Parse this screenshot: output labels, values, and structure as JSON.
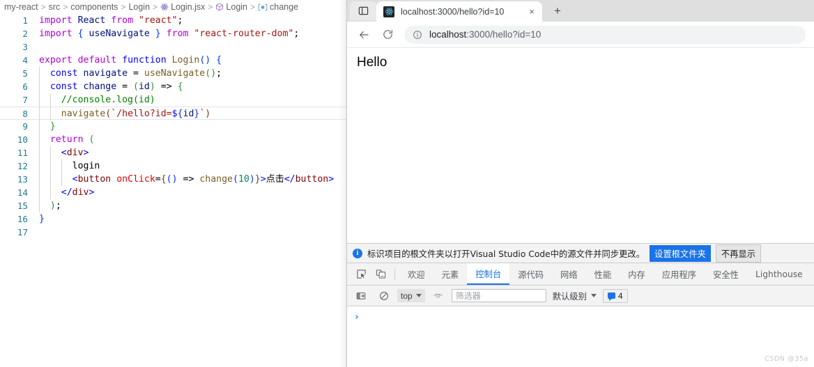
{
  "editor": {
    "breadcrumb": [
      {
        "label": "my-react",
        "icon": null
      },
      {
        "label": "src",
        "icon": null
      },
      {
        "label": "components",
        "icon": null
      },
      {
        "label": "Login",
        "icon": null
      },
      {
        "label": "Login.jsx",
        "icon": "react-file-icon"
      },
      {
        "label": "Login",
        "icon": "cube-symbol-icon"
      },
      {
        "label": "change",
        "icon": "method-symbol-icon"
      }
    ],
    "separator": ">",
    "current_line": 8,
    "lines": [
      {
        "n": "1",
        "tokens": [
          {
            "t": "import",
            "c": "t-kw"
          },
          {
            "t": " ",
            "c": "t-plain"
          },
          {
            "t": "React",
            "c": "t-var"
          },
          {
            "t": " ",
            "c": "t-plain"
          },
          {
            "t": "from",
            "c": "t-kw"
          },
          {
            "t": " ",
            "c": "t-plain"
          },
          {
            "t": "\"react\"",
            "c": "t-str"
          },
          {
            "t": ";",
            "c": "t-plain"
          }
        ]
      },
      {
        "n": "2",
        "tokens": [
          {
            "t": "import",
            "c": "t-kw"
          },
          {
            "t": " ",
            "c": "t-plain"
          },
          {
            "t": "{",
            "c": "t-brk1"
          },
          {
            "t": " ",
            "c": "t-plain"
          },
          {
            "t": "useNavigate",
            "c": "t-var"
          },
          {
            "t": " ",
            "c": "t-plain"
          },
          {
            "t": "}",
            "c": "t-brk1"
          },
          {
            "t": " ",
            "c": "t-plain"
          },
          {
            "t": "from",
            "c": "t-kw"
          },
          {
            "t": " ",
            "c": "t-plain"
          },
          {
            "t": "\"react-router-dom\"",
            "c": "t-str"
          },
          {
            "t": ";",
            "c": "t-plain"
          }
        ]
      },
      {
        "n": "3",
        "tokens": []
      },
      {
        "n": "4",
        "tokens": [
          {
            "t": "export",
            "c": "t-kw"
          },
          {
            "t": " ",
            "c": "t-plain"
          },
          {
            "t": "default",
            "c": "t-kw"
          },
          {
            "t": " ",
            "c": "t-plain"
          },
          {
            "t": "function",
            "c": "t-kw2"
          },
          {
            "t": " ",
            "c": "t-plain"
          },
          {
            "t": "Login",
            "c": "t-fn"
          },
          {
            "t": "(",
            "c": "t-brk1"
          },
          {
            "t": ")",
            "c": "t-brk1"
          },
          {
            "t": " ",
            "c": "t-plain"
          },
          {
            "t": "{",
            "c": "t-brk1"
          }
        ]
      },
      {
        "n": "5",
        "tokens": [
          {
            "t": "  ",
            "c": "t-plain"
          },
          {
            "t": "const",
            "c": "t-kw2"
          },
          {
            "t": " ",
            "c": "t-plain"
          },
          {
            "t": "navigate",
            "c": "t-var"
          },
          {
            "t": " = ",
            "c": "t-plain"
          },
          {
            "t": "useNavigate",
            "c": "t-fn"
          },
          {
            "t": "(",
            "c": "t-brk2"
          },
          {
            "t": ")",
            "c": "t-brk2"
          },
          {
            "t": ";",
            "c": "t-plain"
          }
        ]
      },
      {
        "n": "6",
        "tokens": [
          {
            "t": "  ",
            "c": "t-plain"
          },
          {
            "t": "const",
            "c": "t-kw2"
          },
          {
            "t": " ",
            "c": "t-plain"
          },
          {
            "t": "change",
            "c": "t-var"
          },
          {
            "t": " = ",
            "c": "t-plain"
          },
          {
            "t": "(",
            "c": "t-brk2"
          },
          {
            "t": "id",
            "c": "t-var"
          },
          {
            "t": ")",
            "c": "t-brk2"
          },
          {
            "t": " => ",
            "c": "t-plain"
          },
          {
            "t": "{",
            "c": "t-brk2"
          }
        ]
      },
      {
        "n": "7",
        "tokens": [
          {
            "t": "    ",
            "c": "t-plain"
          },
          {
            "t": "//console.log(id)",
            "c": "t-cmt"
          }
        ]
      },
      {
        "n": "8",
        "tokens": [
          {
            "t": "    ",
            "c": "t-plain"
          },
          {
            "t": "navigate",
            "c": "t-fn"
          },
          {
            "t": "(",
            "c": "t-brk3"
          },
          {
            "t": "`/hello?id=",
            "c": "t-str"
          },
          {
            "t": "$",
            "c": "t-sub"
          },
          {
            "t": "{",
            "c": "t-brk1"
          },
          {
            "t": "id",
            "c": "t-var"
          },
          {
            "t": "}",
            "c": "t-brk1"
          },
          {
            "t": "`",
            "c": "t-str"
          },
          {
            "t": ")",
            "c": "t-brk3"
          }
        ]
      },
      {
        "n": "9",
        "tokens": [
          {
            "t": "  ",
            "c": "t-plain"
          },
          {
            "t": "}",
            "c": "t-brk2"
          }
        ]
      },
      {
        "n": "10",
        "tokens": [
          {
            "t": "  ",
            "c": "t-plain"
          },
          {
            "t": "return",
            "c": "t-kw"
          },
          {
            "t": " ",
            "c": "t-plain"
          },
          {
            "t": "(",
            "c": "t-brk2"
          }
        ]
      },
      {
        "n": "11",
        "tokens": [
          {
            "t": "    ",
            "c": "t-plain"
          },
          {
            "t": "<",
            "c": "t-tagb"
          },
          {
            "t": "div",
            "c": "t-tag"
          },
          {
            "t": ">",
            "c": "t-tagb"
          }
        ]
      },
      {
        "n": "12",
        "tokens": [
          {
            "t": "      ",
            "c": "t-plain"
          },
          {
            "t": "login",
            "c": "t-plain"
          }
        ]
      },
      {
        "n": "13",
        "tokens": [
          {
            "t": "      ",
            "c": "t-plain"
          },
          {
            "t": "<",
            "c": "t-tagb"
          },
          {
            "t": "button",
            "c": "t-tag"
          },
          {
            "t": " ",
            "c": "t-plain"
          },
          {
            "t": "onClick",
            "c": "t-attr"
          },
          {
            "t": "=",
            "c": "t-plain"
          },
          {
            "t": "{",
            "c": "t-brk3"
          },
          {
            "t": "(",
            "c": "t-brk1"
          },
          {
            "t": ")",
            "c": "t-brk1"
          },
          {
            "t": " => ",
            "c": "t-plain"
          },
          {
            "t": "change",
            "c": "t-fn"
          },
          {
            "t": "(",
            "c": "t-brk1"
          },
          {
            "t": "10",
            "c": "t-num"
          },
          {
            "t": ")",
            "c": "t-brk1"
          },
          {
            "t": "}",
            "c": "t-brk3"
          },
          {
            "t": ">",
            "c": "t-tagb"
          },
          {
            "t": "点击",
            "c": "t-cjk"
          },
          {
            "t": "</",
            "c": "t-tagb"
          },
          {
            "t": "button",
            "c": "t-tag"
          },
          {
            "t": ">",
            "c": "t-tagb"
          }
        ]
      },
      {
        "n": "14",
        "tokens": [
          {
            "t": "    ",
            "c": "t-plain"
          },
          {
            "t": "</",
            "c": "t-tagb"
          },
          {
            "t": "div",
            "c": "t-tag"
          },
          {
            "t": ">",
            "c": "t-tagb"
          }
        ]
      },
      {
        "n": "15",
        "tokens": [
          {
            "t": "  ",
            "c": "t-plain"
          },
          {
            "t": ")",
            "c": "t-brk2"
          },
          {
            "t": ";",
            "c": "t-plain"
          }
        ]
      },
      {
        "n": "16",
        "tokens": [
          {
            "t": "}",
            "c": "t-brk1"
          }
        ]
      },
      {
        "n": "17",
        "tokens": []
      }
    ]
  },
  "browser": {
    "window_controls_icon": "tab-search-panel-icon",
    "tab": {
      "favicon": "react-favicon",
      "title": "localhost:3000/hello?id=10",
      "close_label": "×"
    },
    "new_tab_label": "+",
    "nav": {
      "back_icon": "arrow-left-icon",
      "reload_icon": "reload-icon",
      "info_icon": "info-circle-icon",
      "url_host": "localhost",
      "url_path": ":3000/hello?id=10"
    },
    "page": {
      "heading": "Hello"
    }
  },
  "devtools": {
    "notice": {
      "icon": "info-icon",
      "text": "标识项目的根文件夹以打开Visual Studio Code中的源文件并同步更改。",
      "primary_button": "设置根文件夹",
      "secondary_button": "不再显示"
    },
    "tool_icons": [
      "inspect-element-icon",
      "device-toolbar-icon"
    ],
    "tabs": [
      {
        "label": "欢迎",
        "active": false
      },
      {
        "label": "元素",
        "active": false
      },
      {
        "label": "控制台",
        "active": true
      },
      {
        "label": "源代码",
        "active": false
      },
      {
        "label": "网络",
        "active": false
      },
      {
        "label": "性能",
        "active": false
      },
      {
        "label": "内存",
        "active": false
      },
      {
        "label": "应用程序",
        "active": false
      },
      {
        "label": "安全性",
        "active": false
      },
      {
        "label": "Lighthouse",
        "active": false
      }
    ],
    "console_toolbar": {
      "sidebar_icon": "console-sidebar-icon",
      "clear_icon": "clear-console-icon",
      "context": "top",
      "eye_icon": "live-expression-icon",
      "filter_placeholder": "筛选器",
      "filter_value": "",
      "level": "默认级别",
      "message_count": "4",
      "message_icon": "message-bubble-icon"
    },
    "console_prompt": "›"
  },
  "watermark": "CSDN @35a",
  "colors": {
    "accent_blue": "#1a73e8",
    "chrome_tabstrip": "#dfdfdf",
    "devtools_bg": "#f3f3f3",
    "linenum": "#237893"
  }
}
